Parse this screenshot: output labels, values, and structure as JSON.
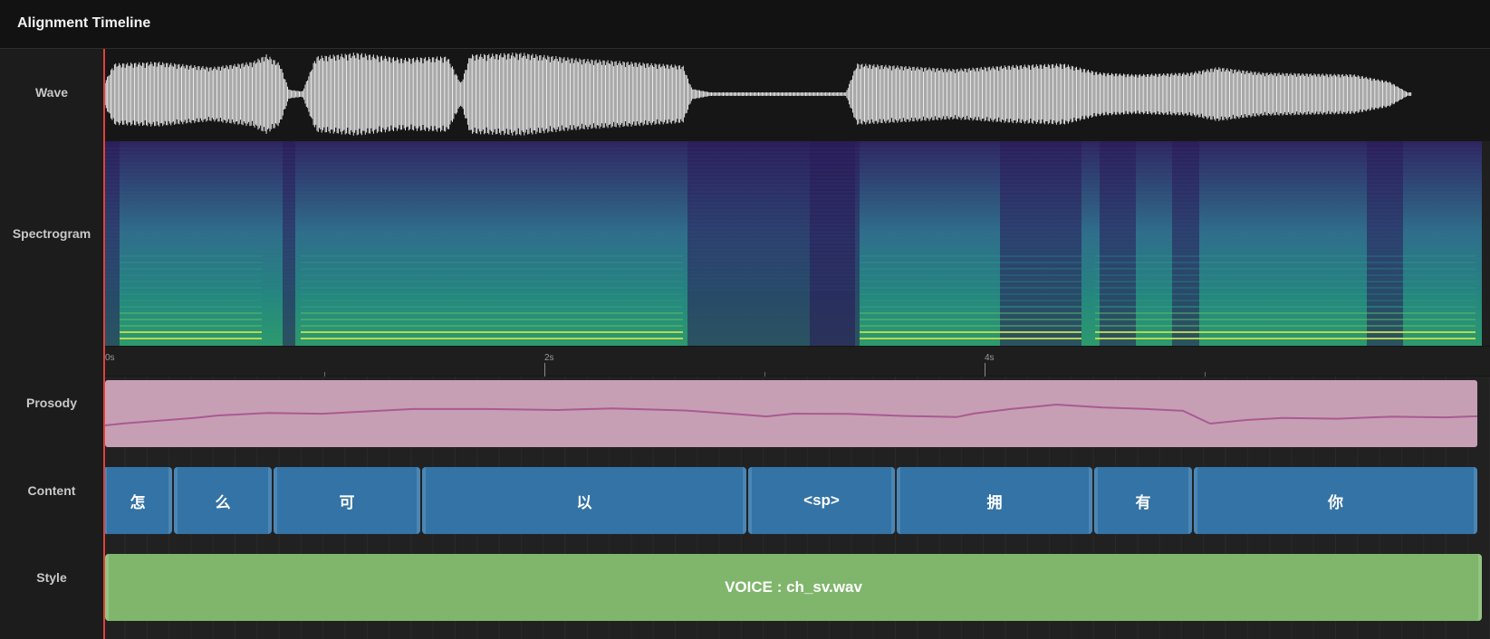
{
  "header": {
    "title": "Alignment Timeline"
  },
  "rows": {
    "wave": "Wave",
    "spectrogram": "Spectrogram",
    "prosody": "Prosody",
    "content": "Content",
    "style": "Style"
  },
  "ruler": {
    "ticks": [
      "0s",
      "2s",
      "4s"
    ]
  },
  "content": {
    "phonemes": [
      "怎",
      "么",
      "可",
      "以",
      "<sp>",
      "拥",
      "有",
      "你"
    ]
  },
  "style": {
    "label": "VOICE : ch_sv.wav"
  },
  "colors": {
    "playhead": "#e0413a",
    "prosody_block": "#c79fb4",
    "prosody_line": "#a95a93",
    "phoneme_block": "#3473a5",
    "style_block": "#7fb66c"
  }
}
